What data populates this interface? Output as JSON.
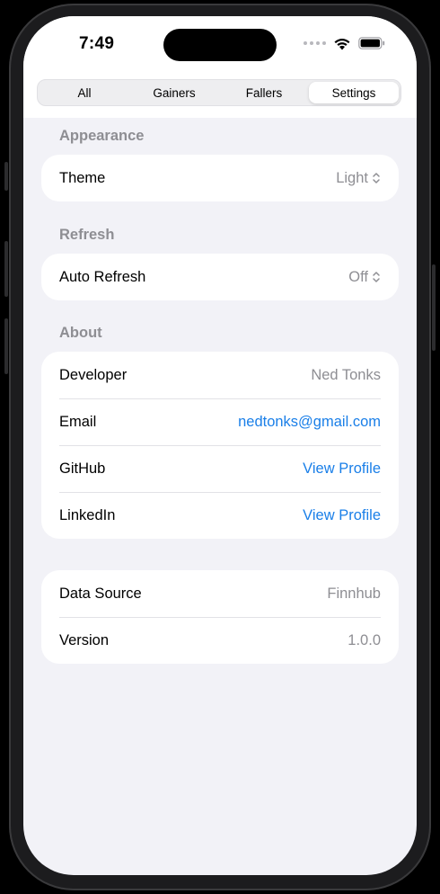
{
  "status_bar": {
    "time": "7:49"
  },
  "tabs": [
    {
      "label": "All",
      "active": false
    },
    {
      "label": "Gainers",
      "active": false
    },
    {
      "label": "Fallers",
      "active": false
    },
    {
      "label": "Settings",
      "active": true
    }
  ],
  "appearance": {
    "header": "Appearance",
    "theme": {
      "label": "Theme",
      "value": "Light"
    }
  },
  "refresh": {
    "header": "Refresh",
    "auto_refresh": {
      "label": "Auto Refresh",
      "value": "Off"
    }
  },
  "about": {
    "header": "About",
    "developer": {
      "label": "Developer",
      "value": "Ned Tonks"
    },
    "email": {
      "label": "Email",
      "value": "nedtonks@gmail.com"
    },
    "github": {
      "label": "GitHub",
      "value": "View Profile"
    },
    "linkedin": {
      "label": "LinkedIn",
      "value": "View Profile"
    }
  },
  "info": {
    "data_source": {
      "label": "Data Source",
      "value": "Finnhub"
    },
    "version": {
      "label": "Version",
      "value": "1.0.0"
    }
  },
  "colors": {
    "accent": "#1a7fe8",
    "secondary_text": "#8e8e93",
    "background": "#f2f2f7"
  }
}
